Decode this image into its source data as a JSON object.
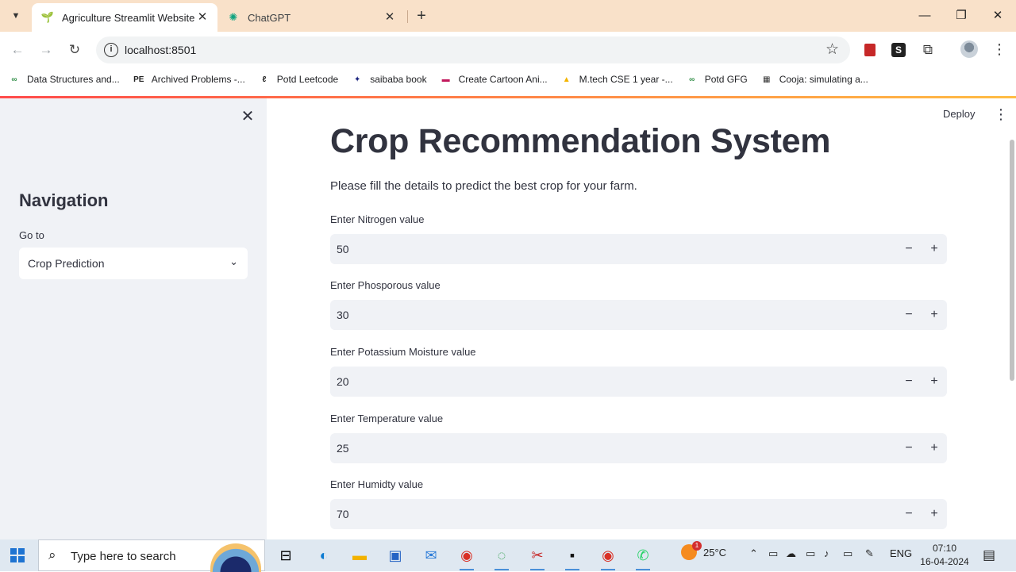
{
  "browser": {
    "tabs": [
      {
        "title": "Agriculture Streamlit Website",
        "active": true
      },
      {
        "title": "ChatGPT",
        "active": false
      }
    ],
    "url": "localhost:8501",
    "bookmarks": [
      {
        "label": "Data Structures and...",
        "icon": "gfg-icon"
      },
      {
        "label": "Archived Problems -...",
        "icon": "pe-icon"
      },
      {
        "label": "Potd Leetcode",
        "icon": "leetcode-icon"
      },
      {
        "label": "saibaba book",
        "icon": "book-icon"
      },
      {
        "label": "Create Cartoon Ani...",
        "icon": "cartoon-icon"
      },
      {
        "label": "M.tech CSE 1 year -...",
        "icon": "drive-icon"
      },
      {
        "label": "Potd GFG",
        "icon": "gfg-icon"
      },
      {
        "label": "Cooja: simulating a...",
        "icon": "cooja-icon"
      }
    ]
  },
  "sidebar": {
    "title": "Navigation",
    "select_label": "Go to",
    "select_value": "Crop Prediction"
  },
  "main": {
    "deploy_label": "Deploy",
    "title": "Crop Recommendation System",
    "subtitle": "Please fill the details to predict the best crop for your farm.",
    "fields": [
      {
        "label": "Enter Nitrogen value",
        "value": "50"
      },
      {
        "label": "Enter Phosporous value",
        "value": "30"
      },
      {
        "label": "Enter Potassium Moisture value",
        "value": "20"
      },
      {
        "label": "Enter Temperature value",
        "value": "25"
      },
      {
        "label": "Enter Humidty value",
        "value": "70"
      }
    ]
  },
  "taskbar": {
    "search_placeholder": "Type here to search",
    "weather_temp": "25°C",
    "weather_badge": "1",
    "language": "ENG",
    "time": "07:10",
    "date": "16-04-2024",
    "notification_count": "1"
  },
  "colors": {
    "accent_gradient_start": "#ff4b4b",
    "accent_gradient_end": "#ffbd45",
    "sidebar_bg": "#f0f2f6",
    "tabstrip_bg": "#f9e1c9"
  }
}
